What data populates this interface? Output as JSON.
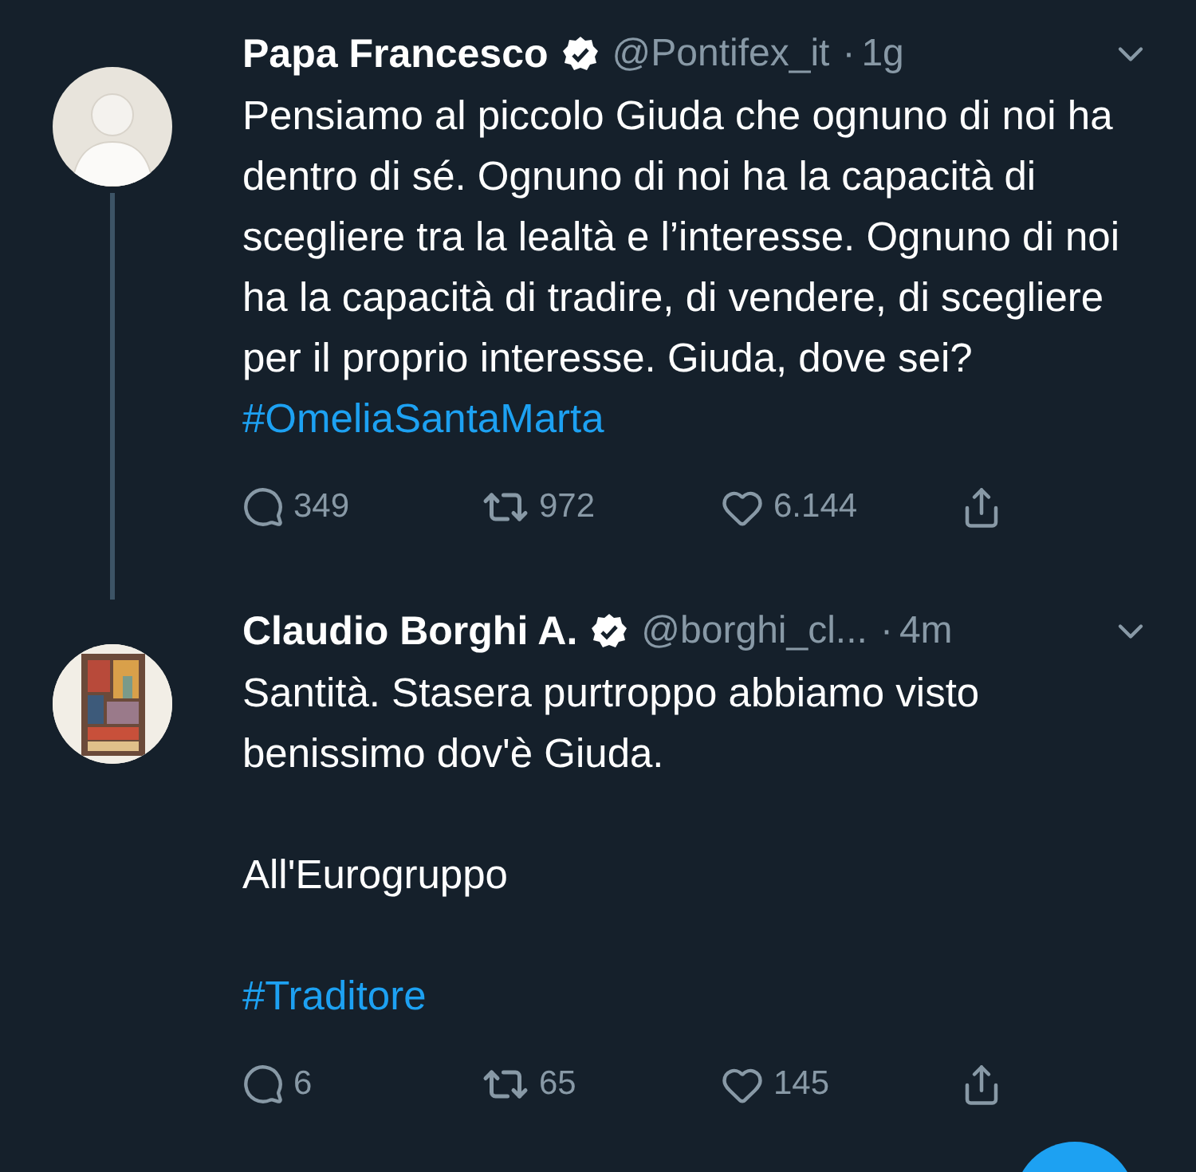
{
  "tweets": [
    {
      "name": "Papa Francesco",
      "verified": true,
      "handle": "@Pontifex_it",
      "separator": "·",
      "time": "1g",
      "avatar": {
        "kind": "silhouette"
      },
      "thread_line": true,
      "paragraphs": [
        "Pensiamo al piccolo Giuda che ognuno di noi ha dentro di sé. Ognuno di noi ha la capacità di scegliere tra la lealtà e l’interesse. Ognuno di noi ha la capacità di tradire, di vendere, di scegliere per il proprio interesse. Giuda, dove sei?"
      ],
      "hashtag": "#OmeliaSantaMarta",
      "replies": "349",
      "retweets": "972",
      "likes": "6.144"
    },
    {
      "name": "Claudio Borghi A.",
      "verified": true,
      "handle": "@borghi_cl...",
      "separator": "·",
      "time": "4m",
      "thread_line": false,
      "paragraphs": [
        "Santità. Stasera purtroppo abbiamo visto benissimo dov'è Giuda.",
        "All'Eurogruppo"
      ],
      "hashtag": "#Traditore",
      "replies": "6",
      "retweets": "65",
      "likes": "145"
    }
  ]
}
